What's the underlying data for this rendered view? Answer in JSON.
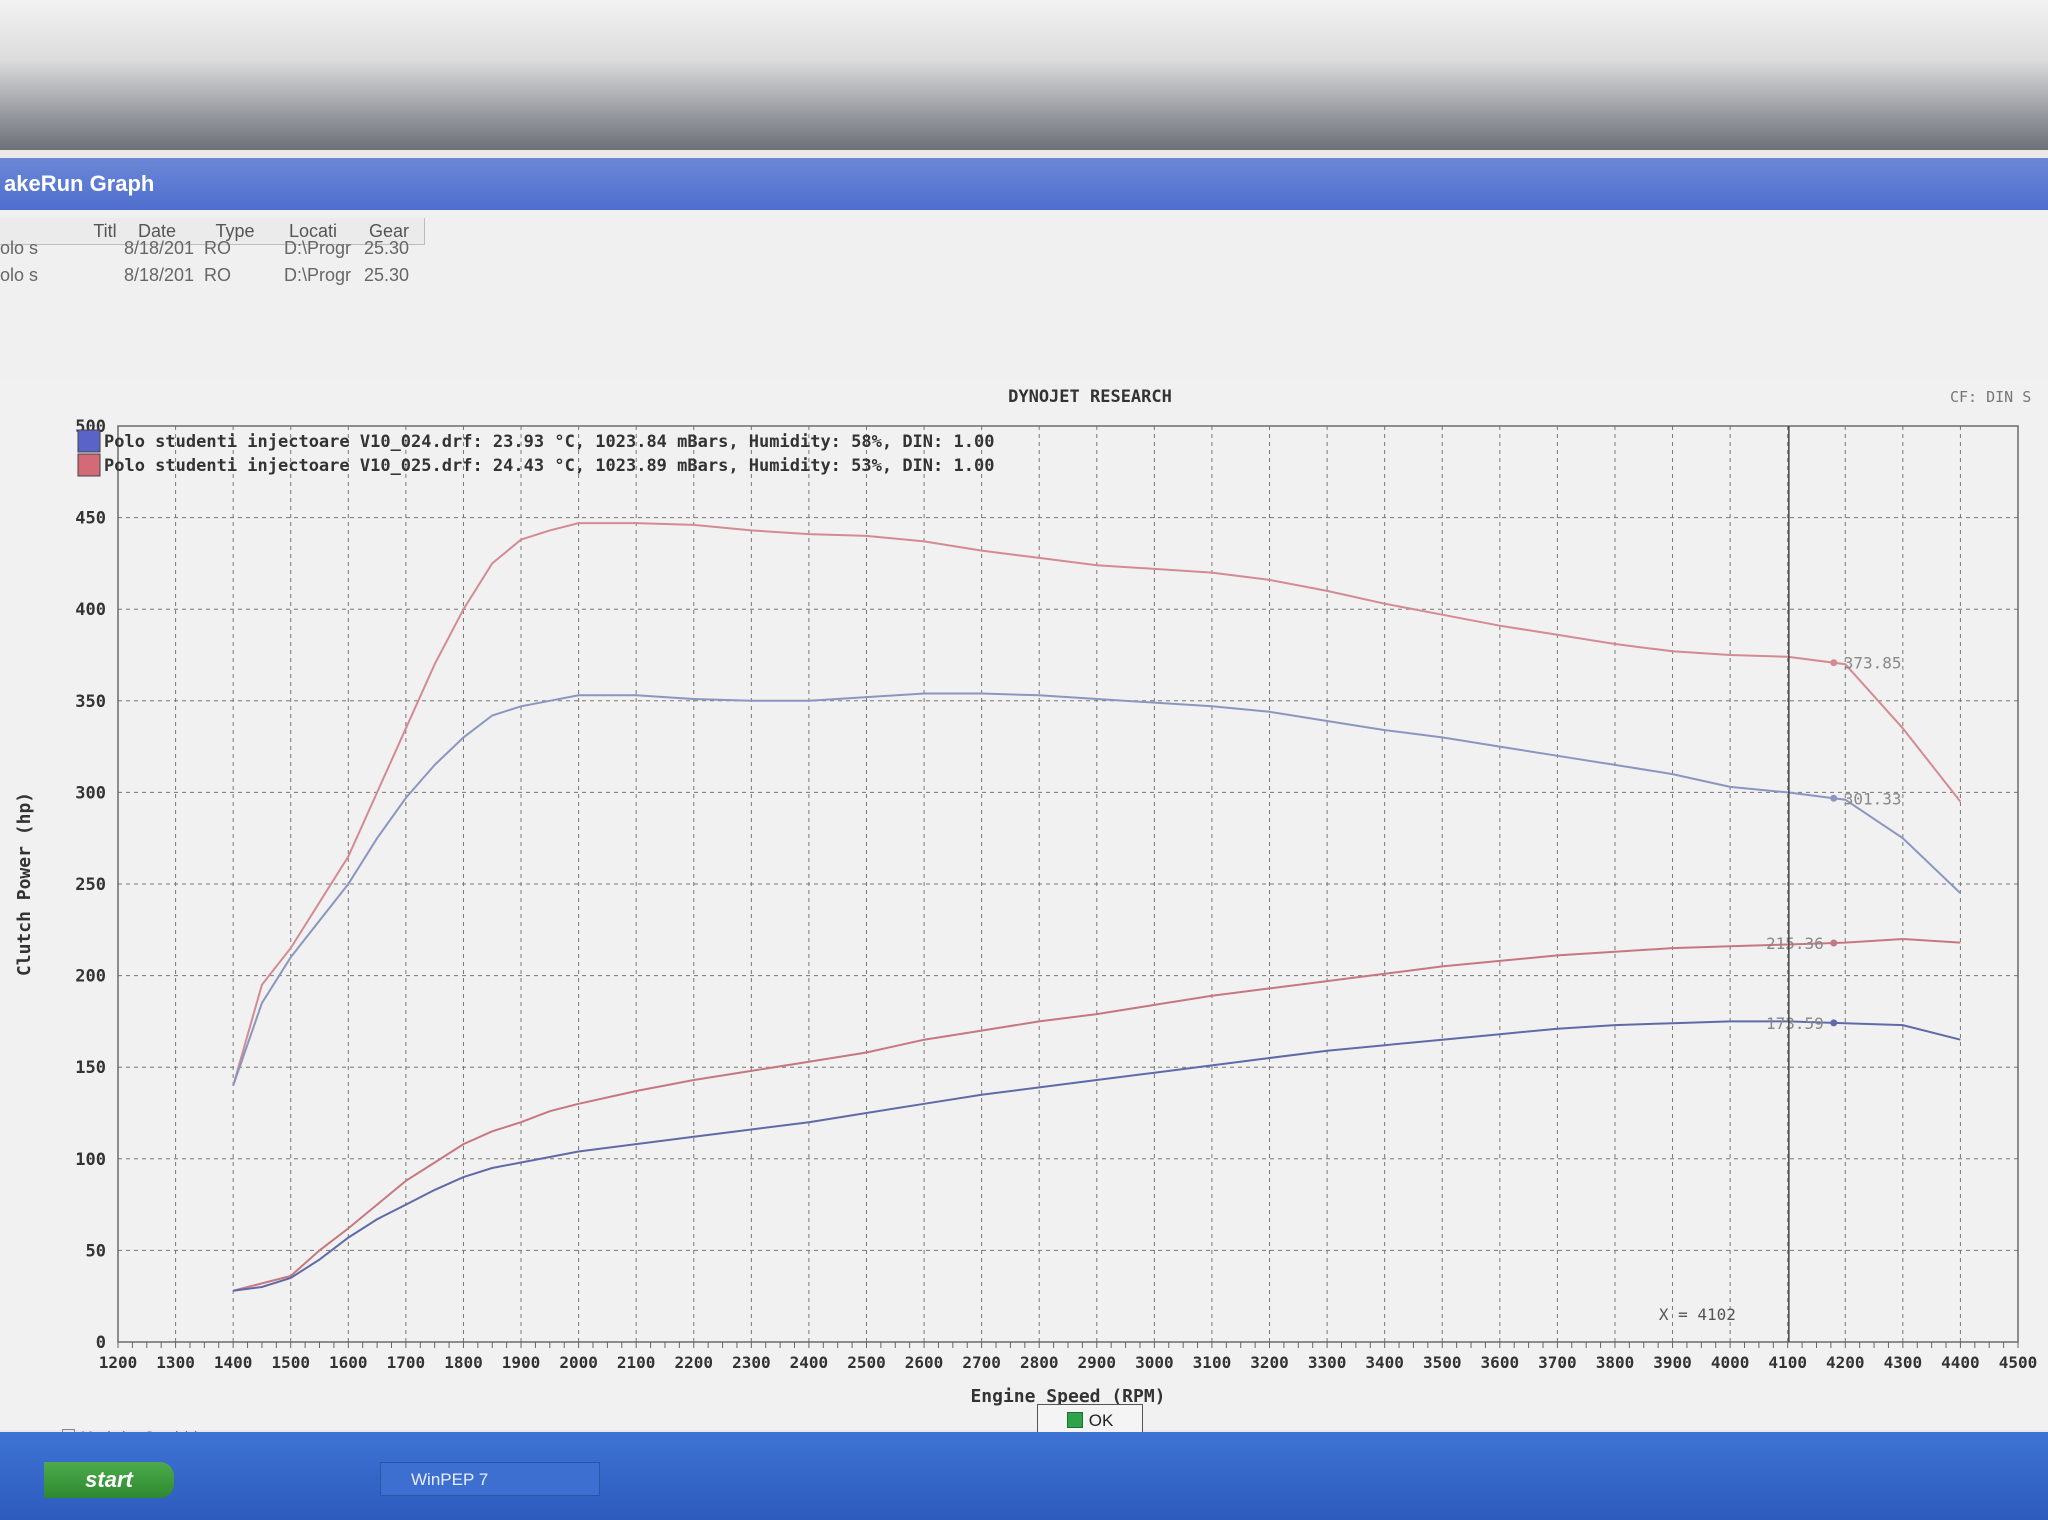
{
  "window": {
    "title": "akeRun Graph"
  },
  "runlist": {
    "columns": [
      "Title",
      "Date",
      "Type",
      "Locati",
      "Gear"
    ],
    "rows": [
      {
        "title": "olo s",
        "date": "8/18/201",
        "type": "RO",
        "location": "D:\\Progr",
        "gear": "25.30"
      },
      {
        "title": "olo s",
        "date": "8/18/201",
        "type": "RO",
        "location": "D:\\Progr",
        "gear": "25.30"
      }
    ]
  },
  "chart_data": {
    "type": "line",
    "title": "DYNOJET RESEARCH",
    "corner_note": "CF: DIN  S",
    "xlabel": "Engine Speed (RPM)",
    "ylabel": "Clutch Power (hp)",
    "xlim": [
      1200,
      4500
    ],
    "ylim": [
      0,
      500
    ],
    "x_ticks": [
      1200,
      1300,
      1400,
      1500,
      1600,
      1700,
      1800,
      1900,
      2000,
      2100,
      2200,
      2300,
      2400,
      2500,
      2600,
      2700,
      2800,
      2900,
      3000,
      3100,
      3200,
      3300,
      3400,
      3500,
      3600,
      3700,
      3800,
      3900,
      4000,
      4100,
      4200,
      4300,
      4400,
      4500
    ],
    "y_ticks": [
      0,
      50,
      100,
      150,
      200,
      250,
      300,
      350,
      400,
      450,
      500
    ],
    "grid": true,
    "legend_position": "top-left",
    "legend": [
      {
        "text": "Polo studenti injectoare V10_024.drf: 23.93 °C, 1023.84 mBars, Humidity: 58%, DIN: 1.00",
        "color": "#5a64c8"
      },
      {
        "text": "Polo studenti injectoare V10_025.drf: 24.43 °C, 1023.89 mBars, Humidity: 53%, DIN: 1.00",
        "color": "#d46a78"
      }
    ],
    "cursor": {
      "x": 4102,
      "label": "X = 4102"
    },
    "series": [
      {
        "color": "#d48a93",
        "end_label": "373.85",
        "x": [
          1400,
          1450,
          1500,
          1550,
          1600,
          1650,
          1700,
          1750,
          1800,
          1850,
          1900,
          1950,
          2000,
          2100,
          2200,
          2300,
          2400,
          2500,
          2600,
          2700,
          2800,
          2900,
          3000,
          3100,
          3200,
          3300,
          3400,
          3500,
          3600,
          3700,
          3800,
          3900,
          4000,
          4100,
          4200,
          4300,
          4400
        ],
        "y": [
          140,
          195,
          215,
          240,
          265,
          300,
          335,
          370,
          400,
          425,
          438,
          443,
          447,
          447,
          446,
          443,
          441,
          440,
          437,
          432,
          428,
          424,
          422,
          420,
          416,
          410,
          403,
          397,
          391,
          386,
          381,
          377,
          375,
          374,
          370,
          335,
          295
        ]
      },
      {
        "color": "#8a96c0",
        "end_label": "301.33",
        "x": [
          1400,
          1450,
          1500,
          1550,
          1600,
          1650,
          1700,
          1750,
          1800,
          1850,
          1900,
          1950,
          2000,
          2100,
          2200,
          2300,
          2400,
          2500,
          2600,
          2700,
          2800,
          2900,
          3000,
          3100,
          3200,
          3300,
          3400,
          3500,
          3600,
          3700,
          3800,
          3900,
          4000,
          4100,
          4200,
          4300,
          4400
        ],
        "y": [
          140,
          185,
          210,
          230,
          250,
          275,
          297,
          315,
          330,
          342,
          347,
          350,
          353,
          353,
          351,
          350,
          350,
          352,
          354,
          354,
          353,
          351,
          349,
          347,
          344,
          339,
          334,
          330,
          325,
          320,
          315,
          310,
          303,
          300,
          296,
          275,
          245
        ]
      },
      {
        "color": "#c7777f",
        "end_label": "215.36",
        "x": [
          1400,
          1450,
          1500,
          1550,
          1600,
          1650,
          1700,
          1750,
          1800,
          1850,
          1900,
          1950,
          2000,
          2100,
          2200,
          2300,
          2400,
          2500,
          2600,
          2700,
          2800,
          2900,
          3000,
          3100,
          3200,
          3300,
          3400,
          3500,
          3600,
          3700,
          3800,
          3900,
          4000,
          4100,
          4200,
          4300,
          4400
        ],
        "y": [
          28,
          32,
          36,
          50,
          62,
          75,
          88,
          98,
          108,
          115,
          120,
          126,
          130,
          137,
          143,
          148,
          153,
          158,
          165,
          170,
          175,
          179,
          184,
          189,
          193,
          197,
          201,
          205,
          208,
          211,
          213,
          215,
          216,
          217,
          218,
          220,
          218
        ]
      },
      {
        "color": "#5f6aa8",
        "end_label": "173.59",
        "x": [
          1400,
          1450,
          1500,
          1550,
          1600,
          1650,
          1700,
          1750,
          1800,
          1850,
          1900,
          1950,
          2000,
          2100,
          2200,
          2300,
          2400,
          2500,
          2600,
          2700,
          2800,
          2900,
          3000,
          3100,
          3200,
          3300,
          3400,
          3500,
          3600,
          3700,
          3800,
          3900,
          4000,
          4100,
          4200,
          4300,
          4400
        ],
        "y": [
          28,
          30,
          35,
          45,
          57,
          67,
          75,
          83,
          90,
          95,
          98,
          101,
          104,
          108,
          112,
          116,
          120,
          125,
          130,
          135,
          139,
          143,
          147,
          151,
          155,
          159,
          162,
          165,
          168,
          171,
          173,
          174,
          175,
          175,
          174,
          173,
          165
        ]
      }
    ]
  },
  "controls": {
    "ok_label": "OK",
    "maximize_label": "Maximize Graph(s)"
  },
  "taskbar": {
    "start_label": "start",
    "app_label": "WinPEP 7"
  }
}
